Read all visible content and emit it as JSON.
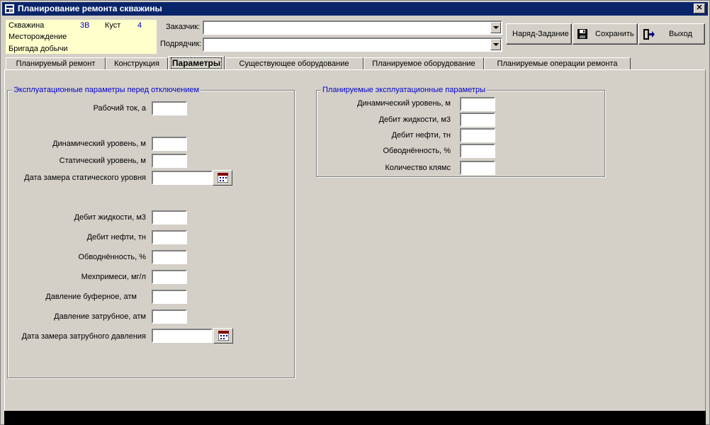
{
  "window": {
    "title": "Планирование ремонта скважины",
    "close_symbol": "✕"
  },
  "info": {
    "well_label": "Скважина",
    "well_value": "3В",
    "cluster_label": "Куст",
    "cluster_value": "4",
    "field_label": "Месторождение",
    "crew_label": "Бригада добычи"
  },
  "header": {
    "customer_label": "Заказчик:",
    "customer_value": "",
    "contractor_label": "Подрядчик:",
    "contractor_value": ""
  },
  "buttons": {
    "order": "Наряд-Задание",
    "save": "Сохранить",
    "exit": "Выход"
  },
  "tabs": [
    "Планируемый ремонт",
    "Конструкция",
    "Параметры",
    "Существующее оборудование",
    "Планируемое оборудование",
    "Планируемые операции ремонта"
  ],
  "left_group": {
    "title": "Эксплуатационные параметры перед отключением",
    "fields": [
      {
        "label": "Рабочий ток, а",
        "value": ""
      },
      {
        "label": "Динамический уровень, м",
        "value": ""
      },
      {
        "label": "Статический уровень, м",
        "value": ""
      },
      {
        "label": "Дата замера статического уровня",
        "value": ""
      },
      {
        "label": "Дебит жидкости, м3",
        "value": ""
      },
      {
        "label": "Дебит нефти, тн",
        "value": ""
      },
      {
        "label": "Обводнённость, %",
        "value": ""
      },
      {
        "label": "Мехпримеси, мг/л",
        "value": ""
      },
      {
        "label": "Давление буферное, атм",
        "value": ""
      },
      {
        "label": "Давление затрубное, атм",
        "value": ""
      },
      {
        "label": "Дата замера затрубного давления",
        "value": ""
      }
    ]
  },
  "right_group": {
    "title": "Планируемые эксплуатационные параметры",
    "fields": [
      {
        "label": "Динамический уровень, м",
        "value": ""
      },
      {
        "label": "Дебит жидкости, м3",
        "value": ""
      },
      {
        "label": "Дебит нефти, тн",
        "value": ""
      },
      {
        "label": "Обводнённость, %",
        "value": ""
      },
      {
        "label": "Количество клямс",
        "value": ""
      }
    ]
  },
  "icons": {
    "app": "app-icon",
    "save": "floppy-disk-icon",
    "exit": "exit-door-icon",
    "calendar": "calendar-icon"
  },
  "colors": {
    "titlebar": "#0a246a",
    "face": "#d4d0c8",
    "info_bg": "#ffffcc",
    "group_title": "#0000cc"
  }
}
